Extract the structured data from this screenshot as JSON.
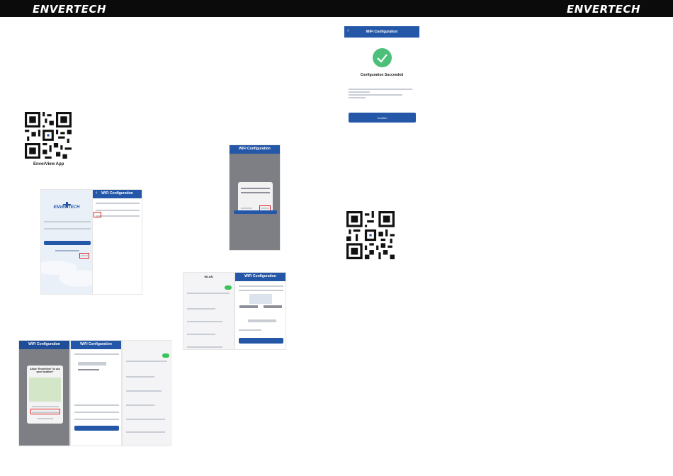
{
  "header": {
    "brand_left": "ENVERTECH",
    "brand_right": "ENVERTECH"
  },
  "qr_app": {
    "caption": "EnverView App"
  },
  "login_screen": {
    "brand": "ENVERTECH",
    "login_label": "Login"
  },
  "wifi_screens": {
    "title": "WiFi Configuration",
    "success": {
      "title": "WiFi Configuration",
      "status": "Configuration Succeeded",
      "confirm_label": "Confirm"
    },
    "permission_prompt": {
      "question": "Allow \"EnverView\" to use your location?"
    }
  },
  "settings_screen": {
    "header": "WLAN"
  }
}
